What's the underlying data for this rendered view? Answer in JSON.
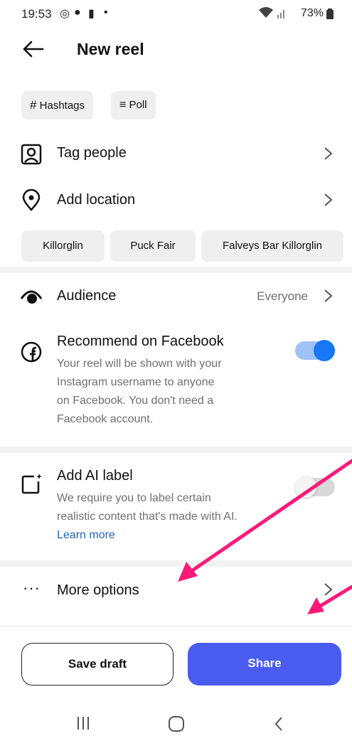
{
  "status_bar": {
    "time": "19:53",
    "right_text": "73%"
  },
  "header": {
    "title": "New reel"
  },
  "chips": [
    {
      "icon": "hash-icon",
      "label": "Hashtags"
    },
    {
      "icon": "poll-icon",
      "label": "Poll"
    }
  ],
  "rows": {
    "tag_people": "Tag people",
    "add_location": "Add location"
  },
  "location_suggestions": [
    "Killorglin",
    "Puck Fair",
    "Falveys Bar Killorglin"
  ],
  "audience": {
    "label": "Audience",
    "value": "Everyone"
  },
  "facebook": {
    "title": "Recommend on Facebook",
    "desc_lines": [
      "Your reel will be shown with your",
      "Instagram username to anyone",
      "on Facebook. You don't need a",
      "Facebook account."
    ],
    "enabled": true
  },
  "ai_label": {
    "title": "Add AI label",
    "desc_lines": [
      "We require you to label certain",
      "realistic content that's made with AI."
    ],
    "learn_more": "Learn more",
    "enabled": false
  },
  "more_options": "More options",
  "buttons": {
    "save_draft": "Save draft",
    "share": "Share"
  },
  "colors": {
    "accent": "#4a5cf0",
    "toggle_on_track": "#9ec2f5",
    "toggle_on_knob": "#1877f2",
    "link": "#2563b8",
    "annotation": "#ff1a7a"
  }
}
